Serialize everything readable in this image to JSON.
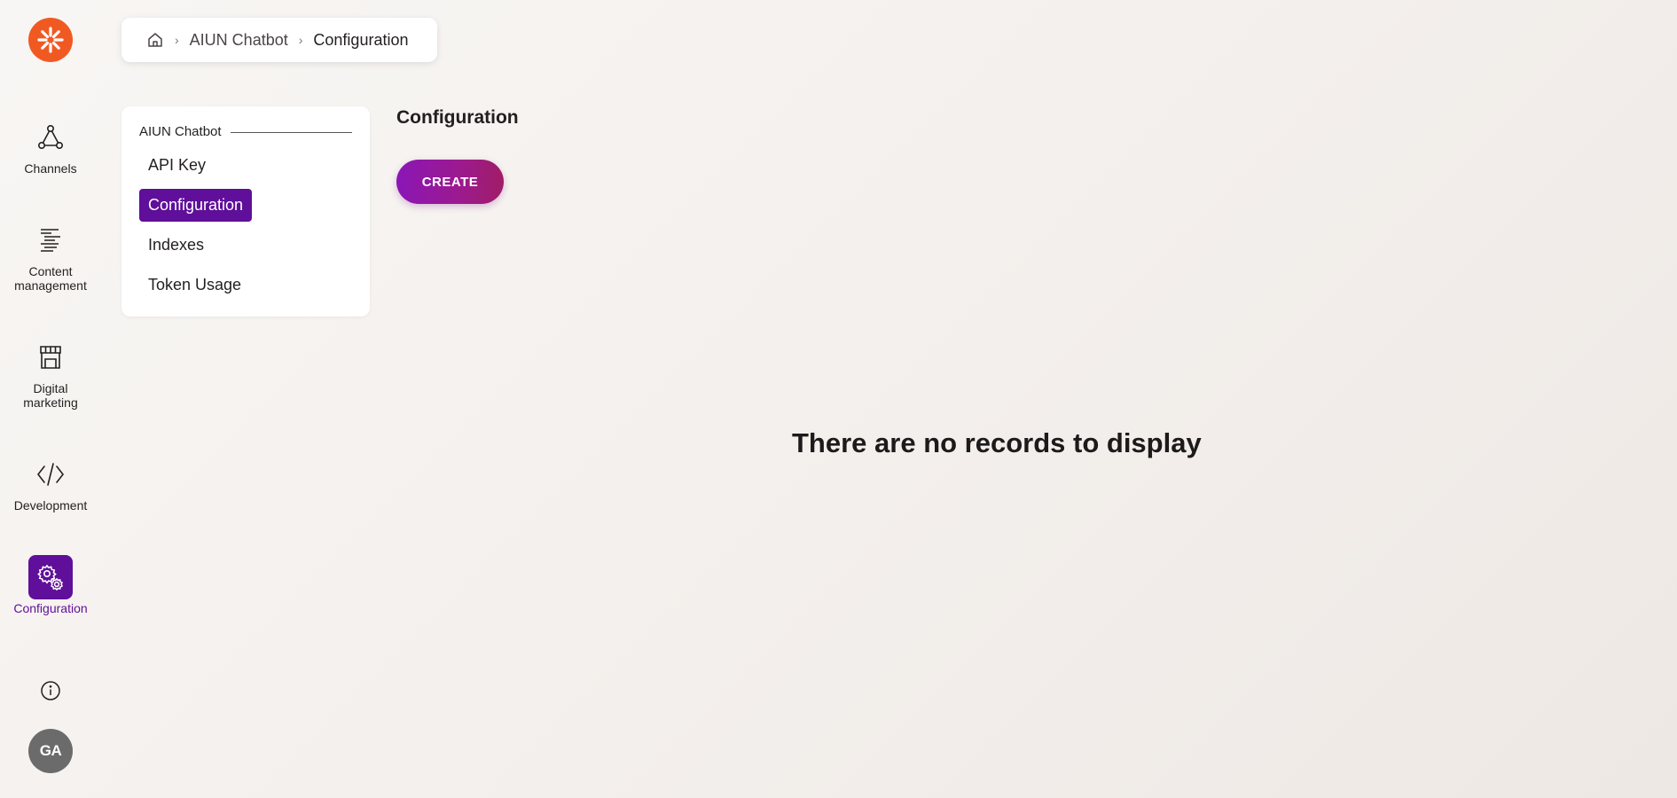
{
  "rail": {
    "items": [
      {
        "label": "Channels",
        "icon": "channels-icon"
      },
      {
        "label": "Content\nmanagement",
        "icon": "content-management-icon"
      },
      {
        "label": "Digital\nmarketing",
        "icon": "storefront-icon"
      },
      {
        "label": "Development",
        "icon": "code-icon"
      },
      {
        "label": "Configuration",
        "icon": "gears-icon"
      }
    ],
    "avatar_initials": "GA"
  },
  "breadcrumb": {
    "items": [
      "AIUN Chatbot",
      "Configuration"
    ],
    "separator": "›"
  },
  "subnav": {
    "heading": "AIUN Chatbot",
    "items": [
      "API Key",
      "Configuration",
      "Indexes",
      "Token Usage"
    ],
    "active_index": 1
  },
  "main": {
    "title": "Configuration",
    "create_label": "CREATE",
    "empty_message": "There are no records to display"
  },
  "colors": {
    "brand_orange": "#f05a22",
    "accent_purple": "#5f0f9a",
    "button_gradient_start": "#8a16b6",
    "button_gradient_end": "#a01d66"
  }
}
